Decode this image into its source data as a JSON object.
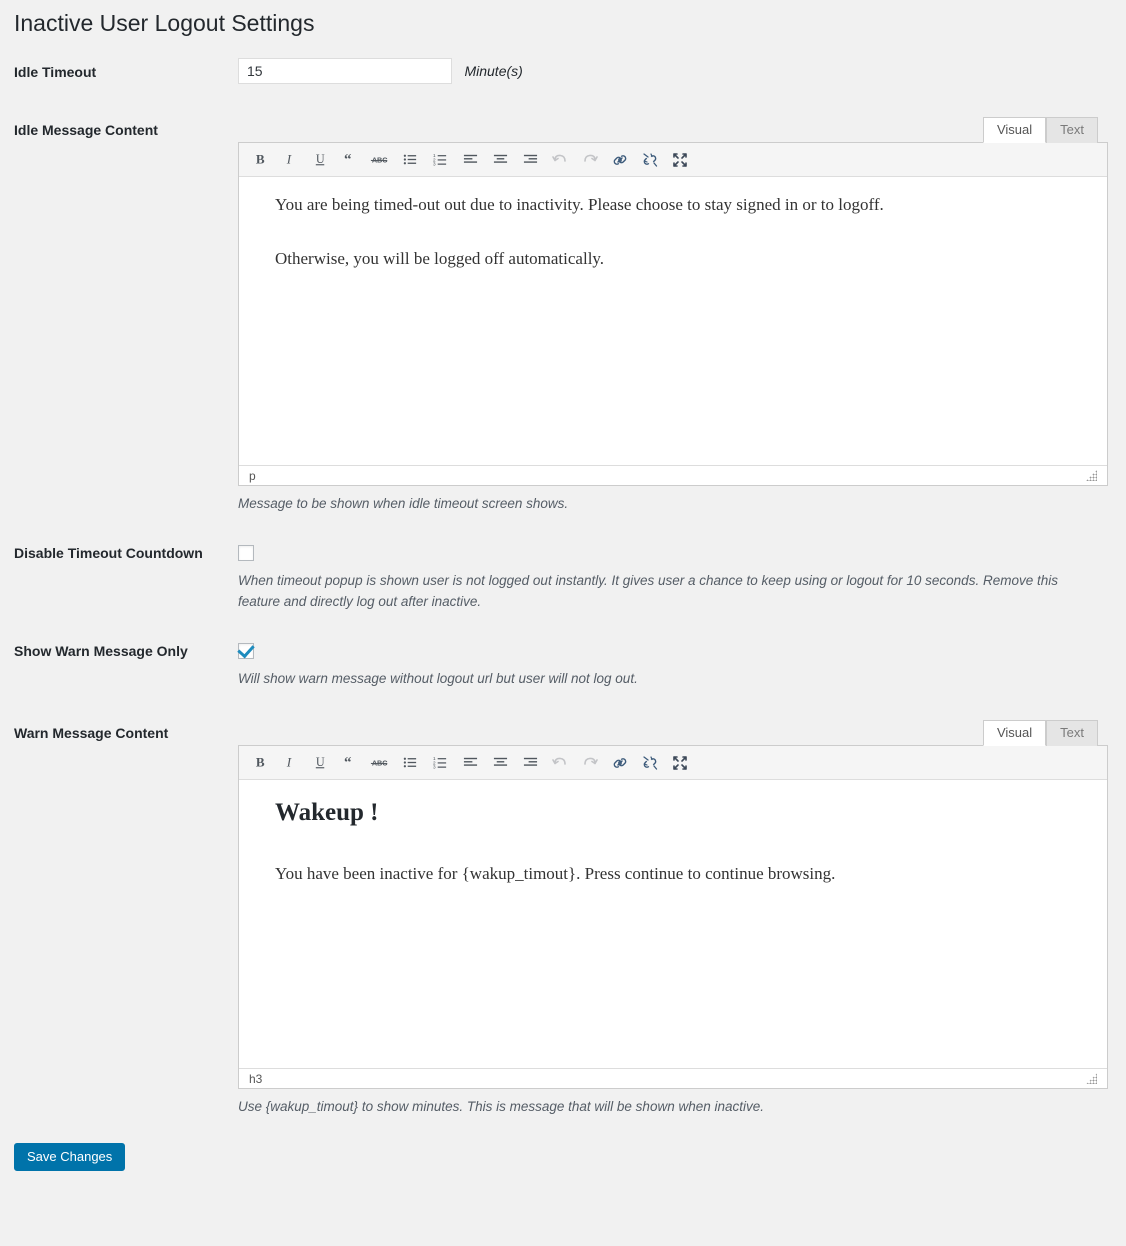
{
  "page": {
    "title": "Inactive User Logout Settings"
  },
  "fields": {
    "idle_timeout": {
      "label": "Idle Timeout",
      "value": "15",
      "unit": "Minute(s)"
    },
    "idle_message": {
      "label": "Idle Message Content",
      "description": "Message to be shown when idle timeout screen shows.",
      "status_path": "p",
      "content": {
        "paragraph_1": "You are being timed-out out due to inactivity. Please choose to stay signed in or to logoff.",
        "paragraph_2": "Otherwise, you will be logged off automatically."
      }
    },
    "disable_countdown": {
      "label": "Disable Timeout Countdown",
      "checked": false,
      "description": "When timeout popup is shown user is not logged out instantly. It gives user a chance to keep using or logout for 10 seconds. Remove this feature and directly log out after inactive."
    },
    "show_warn_only": {
      "label": "Show Warn Message Only",
      "checked": true,
      "description": "Will show warn message without logout url but user will not log out."
    },
    "warn_message": {
      "label": "Warn Message Content",
      "description": "Use {wakup_timout} to show minutes. This is message that will be shown when inactive.",
      "status_path": "h3",
      "content": {
        "heading": "Wakeup !",
        "paragraph_1": "You have been inactive for {wakup_timout}. Press continue to continue browsing."
      }
    }
  },
  "editor_tabs": {
    "visual": "Visual",
    "text": "Text"
  },
  "toolbar": {
    "buttons": [
      {
        "name": "bold-icon",
        "title": "Bold"
      },
      {
        "name": "italic-icon",
        "title": "Italic"
      },
      {
        "name": "underline-icon",
        "title": "Underline"
      },
      {
        "name": "blockquote-icon",
        "title": "Blockquote"
      },
      {
        "name": "strikethrough-icon",
        "title": "Strikethrough"
      },
      {
        "name": "bulleted-list-icon",
        "title": "Bulleted list"
      },
      {
        "name": "numbered-list-icon",
        "title": "Numbered list"
      },
      {
        "name": "align-left-icon",
        "title": "Align left"
      },
      {
        "name": "align-center-icon",
        "title": "Align center"
      },
      {
        "name": "align-right-icon",
        "title": "Align right"
      },
      {
        "name": "undo-icon",
        "title": "Undo"
      },
      {
        "name": "redo-icon",
        "title": "Redo"
      },
      {
        "name": "link-icon",
        "title": "Insert/edit link"
      },
      {
        "name": "unlink-icon",
        "title": "Remove link"
      },
      {
        "name": "fullscreen-icon",
        "title": "Fullscreen"
      }
    ]
  },
  "actions": {
    "save": "Save Changes"
  },
  "colors": {
    "accent": "#0073aa",
    "checkbox_check": "#1e8cbe",
    "page_background": "#f1f1f1",
    "text": "#23282d",
    "description_text": "#555d66"
  }
}
